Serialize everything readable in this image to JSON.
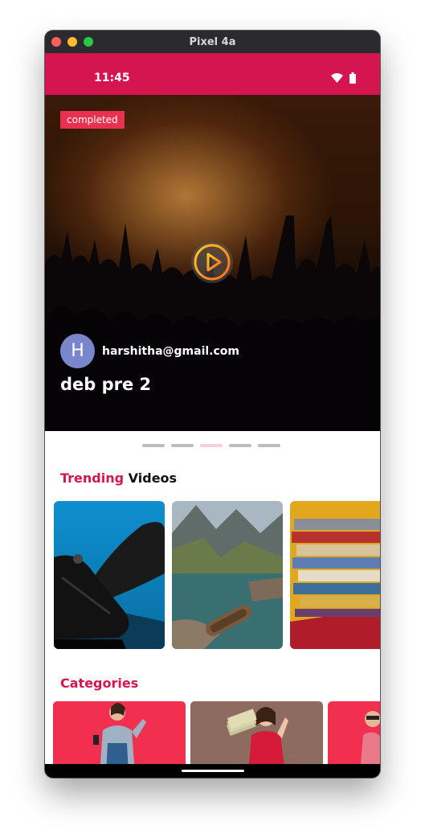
{
  "window": {
    "title": "Pixel 4a"
  },
  "status_bar": {
    "time": "11:45"
  },
  "hero": {
    "badge": "completed",
    "author_initial": "H",
    "author_email": "harshitha@gmail.com",
    "title": "deb pre 2"
  },
  "carousel": {
    "page_count": 5,
    "active_index": 2
  },
  "trending": {
    "heading_accent": "Trending",
    "heading_rest": " Videos",
    "items": [
      {
        "icon": "sneaker-thumbnail"
      },
      {
        "icon": "lake-boat-thumbnail"
      },
      {
        "icon": "books-thumbnail"
      }
    ]
  },
  "categories": {
    "heading": "Categories",
    "items": [
      {
        "bg": "#f1304f"
      },
      {
        "bg": "#8d6b5e"
      },
      {
        "bg": "#f1304f"
      }
    ]
  },
  "colors": {
    "accent": "#d4154f",
    "badge": "#e9304f",
    "avatar": "#7986cb"
  }
}
